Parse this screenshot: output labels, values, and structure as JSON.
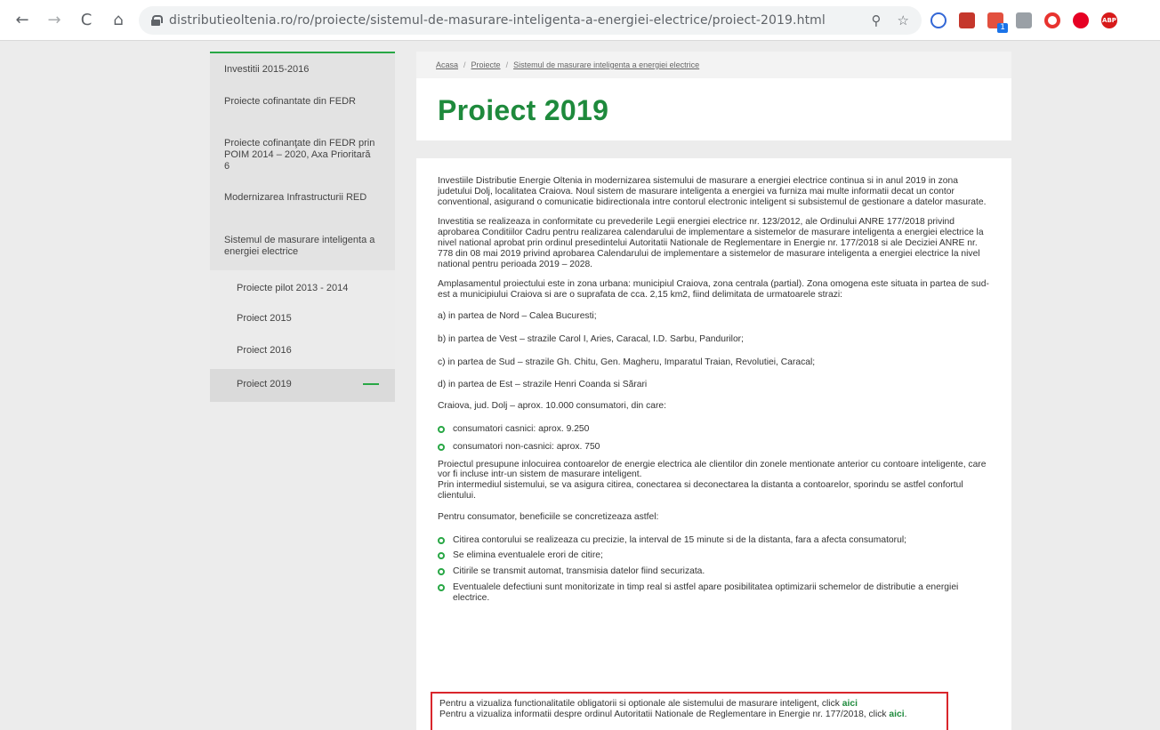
{
  "browser": {
    "url": "distributieoltenia.ro/ro/proiecte/sistemul-de-masurare-inteligenta-a-energiei-electrice/proiect-2019.html",
    "back_glyph": "←",
    "forward_glyph": "→",
    "reload_glyph": "C",
    "home_glyph": "⌂",
    "search_glyph": "⚲",
    "star_glyph": "☆",
    "extensions": [
      "block-icon",
      "pdf-icon",
      "translate-icon",
      "reader-icon",
      "opera-icon",
      "pinterest-icon",
      "adblock-icon"
    ],
    "ext_badge": "1",
    "abp_label": "ABP"
  },
  "sidebar": {
    "items": [
      {
        "label": "Investitii 2015-2016"
      },
      {
        "label": "Proiecte cofinantate din FEDR"
      },
      {
        "label": "Proiecte cofinanţate din FEDR prin POIM 2014 – 2020, Axa Prioritară 6"
      },
      {
        "label": "Modernizarea Infrastructurii RED"
      },
      {
        "label": "Sistemul de masurare inteligenta a energiei electrice"
      }
    ],
    "sub_items": [
      {
        "label": "Proiecte pilot 2013 - 2014"
      },
      {
        "label": "Proiect 2015"
      },
      {
        "label": "Proiect 2016"
      },
      {
        "label": "Proiect 2019"
      }
    ]
  },
  "breadcrumb": {
    "home": "Acasa",
    "projects": "Proiecte",
    "section": "Sistemul de masurare inteligenta a energiei electrice",
    "separator": "/"
  },
  "page": {
    "title": "Proiect 2019"
  },
  "content": {
    "p1": "Investiile Distributie Energie Oltenia in modernizarea sistemului de masurare a energiei electrice continua si in anul 2019 in zona judetului Dolj, localitatea Craiova. Noul sistem de masurare inteligenta a energiei va furniza mai multe informatii decat un contor conventional, asigurand o comunicatie bidirectionala intre contorul electronic inteligent si subsistemul de gestionare a datelor masurate.",
    "p2": "Investitia se realizeaza in conformitate cu prevederile Legii energiei electrice nr. 123/2012, ale Ordinului ANRE 177/2018 privind aprobarea Conditiilor Cadru pentru realizarea calendarului de implementare a sistemelor de masurare inteligenta a energiei electrice la nivel national aprobat prin ordinul presedintelui Autoritatii Nationale de Reglementare in Energie nr. 177/2018 si ale Deciziei ANRE nr. 778 din 08 mai 2019 privind aprobarea Calendarului de implementare a sistemelor de masurare inteligenta a energiei electrice la nivel national pentru perioada 2019 – 2028.",
    "p3": "Amplasamentul proiectului este in zona urbana: municipiul Craiova, zona centrala (partial). Zona omogena este situata in partea de sud-est a municipiului Craiova si are o suprafata de cca. 2,15 km2, fiind delimitata de urmatoarele strazi:",
    "a": "a) in partea de Nord – Calea Bucuresti;",
    "b": "b) in partea de Vest – strazile Carol I, Aries, Caracal, I.D. Sarbu, Pandurilor;",
    "c": "c) in partea de Sud – strazile Gh. Chitu, Gen. Magheru, Imparatul Traian, Revolutiei, Caracal;",
    "d": "d) in partea de Est – strazile Henri Coanda si Sărari",
    "p4": "Craiova, jud. Dolj – aprox. 10.000 consumatori, din care:",
    "cons": [
      "consumatori casnici: aprox. 9.250",
      "consumatori non-casnici: aprox. 750"
    ],
    "p5": "Proiectul presupune inlocuirea contoarelor de energie electrica ale clientilor din zonele mentionate anterior cu contoare inteligente, care vor fi incluse intr-un sistem de masurare inteligent.",
    "p6": "Prin intermediul sistemului, se va asigura citirea, conectarea si deconectarea la distanta a contoarelor, sporindu se astfel confortul clientului.",
    "p7": "Pentru consumator, beneficiile se concretizeaza astfel:",
    "benefits": [
      "Citirea contorului se realizeaza cu precizie, la interval de 15 minute si de la distanta, fara a afecta consumatorul;",
      "Se elimina eventualele erori de citire;",
      "Citirile se transmit automat, transmisia datelor fiind securizata.",
      "Eventualele defectiuni sunt monitorizate in timp real si astfel apare posibilitatea optimizarii schemelor de distributie a energiei electrice."
    ],
    "callout_1": "Pentru a vizualiza functionalitatile obligatorii si optionale ale sistemului de masurare inteligent, click",
    "callout_2": "Pentru a vizualiza informatii despre ordinul Autoritatii Nationale de Reglementare in Energie nr. 177/2018, click",
    "link_label": "aici",
    "period": "."
  },
  "colors": {
    "accent": "#28a745",
    "title_green": "#1e8a3c",
    "callout_border": "#d9262c"
  }
}
